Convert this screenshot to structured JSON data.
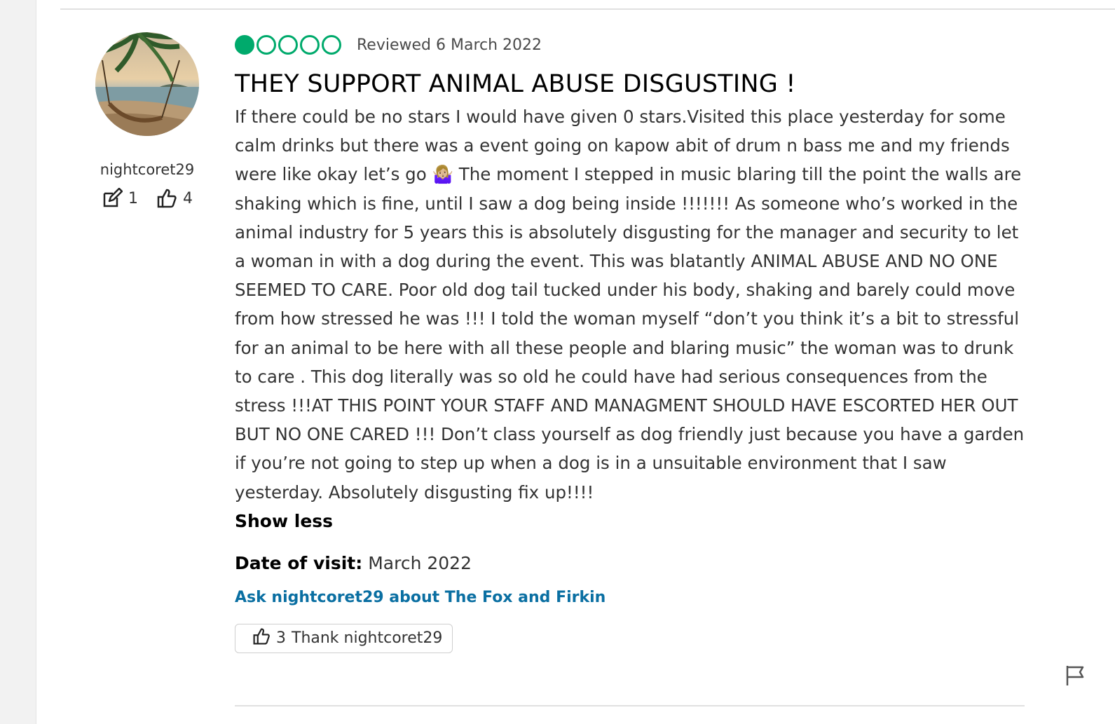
{
  "user": {
    "username": "nightcoret29",
    "contributions": "1",
    "helpful_votes": "4",
    "avatar_icon": "beach-hammock-photo"
  },
  "review": {
    "rating_bubbles": 1,
    "rating_max": 5,
    "reviewed_label": "Reviewed 6 March 2022",
    "title": "THEY SUPPORT ANIMAL ABUSE DISGUSTING !",
    "body": "If there could be no stars I would have given 0 stars.Visited this place yesterday for some calm drinks but there was a event going on kapow abit of drum n bass me and my friends were like okay let’s go 🤷🏼‍♀️ The moment I stepped in music blaring till the point the walls are shaking which is fine, until I saw a dog being inside !!!!!!! As someone who’s worked in the animal industry for 5 years this is absolutely disgusting for the manager and security to let a woman in with a dog during the event. This was blatantly ANIMAL ABUSE AND NO ONE SEEMED TO CARE. Poor old dog tail tucked under his body, shaking and barely could move from how stressed he was !!! I told the woman myself “don’t you think it’s a bit to stressful for an animal to be here with all these people and blaring music” the woman was to drunk to care . This dog literally was so old he could have had serious consequences from the stress !!!AT THIS POINT YOUR STAFF AND MANAGMENT SHOULD HAVE ESCORTED HER OUT BUT NO ONE CARED !!! Don’t class yourself as dog friendly just because you have a garden if you’re not going to step up when a dog is in a unsuitable environment that I saw yesterday. Absolutely disgusting fix up!!!!",
    "show_less_label": "Show less",
    "visit_label": "Date of visit:",
    "visit_value": "March 2022",
    "ask_link": "Ask nightcoret29 about The Fox and Firkin",
    "thank_count": "3",
    "thank_label": "Thank nightcoret29"
  },
  "colors": {
    "bubble_green": "#00aa6c",
    "link_blue": "#0a6fa2"
  }
}
